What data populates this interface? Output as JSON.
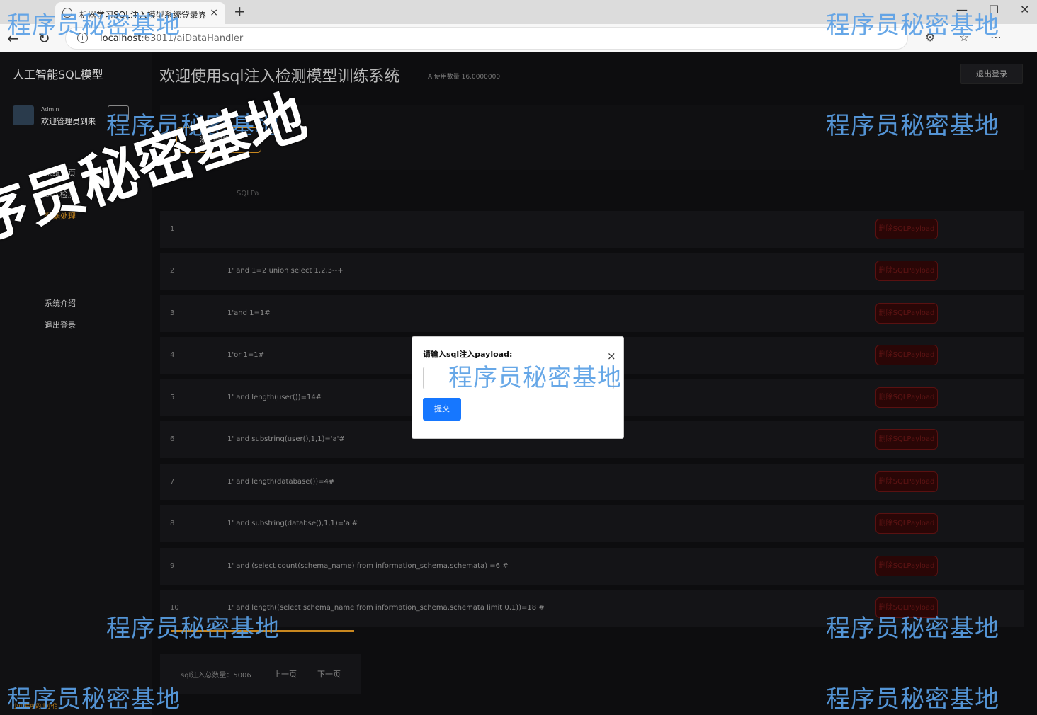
{
  "browser": {
    "tab_title": "机器学习SQL注入模型系统登录界",
    "url_host": "localhost",
    "url_path": ":63011/aiDataHandler"
  },
  "sidebar": {
    "brand": "人工智能SQL模型",
    "admin_label": "Admin",
    "welcome": "欢迎管理员到来",
    "items": [
      {
        "label": "系统首页"
      },
      {
        "label": "SQL检测"
      },
      {
        "label": "数据处理"
      },
      {
        "label": "系统介绍"
      },
      {
        "label": "退出登录"
      }
    ],
    "footer": "小小程序的小小信"
  },
  "header": {
    "title": "欢迎使用sql注入检测模型训练系统",
    "ai_count": "AI使用数量 16,0000000",
    "logout": "退出登录"
  },
  "toolbar": {
    "add_dataset": "添加数据集"
  },
  "table": {
    "header_label": "SQLPa",
    "delete_label": "删除SQLPayload",
    "rows": [
      {
        "idx": "1",
        "payload": ""
      },
      {
        "idx": "2",
        "payload": "1' and 1=2 union select 1,2,3--+"
      },
      {
        "idx": "3",
        "payload": "1'and 1=1#"
      },
      {
        "idx": "4",
        "payload": "1'or 1=1#"
      },
      {
        "idx": "5",
        "payload": "1' and length(user())=14#"
      },
      {
        "idx": "6",
        "payload": "1' and substring(user(),1,1)='a'#"
      },
      {
        "idx": "7",
        "payload": "1' and length(database())=4#"
      },
      {
        "idx": "8",
        "payload": "1' and substring(databse(),1,1)='a'#"
      },
      {
        "idx": "9",
        "payload": "1' and (select count(schema_name) from information_schema.schemata) =6 #"
      },
      {
        "idx": "10",
        "payload": "1' and length((select schema_name from information_schema.schemata limit 0,1))=18 #"
      }
    ]
  },
  "pager": {
    "total": "sql注入总数量：5006",
    "prev": "上一页",
    "next": "下一页"
  },
  "modal": {
    "title": "请输入sql注入payload:",
    "close": "×",
    "input_value": "",
    "submit": "提交"
  },
  "watermark": {
    "text": "程序员秘密基地",
    "big_text": "序员秘密基地"
  }
}
